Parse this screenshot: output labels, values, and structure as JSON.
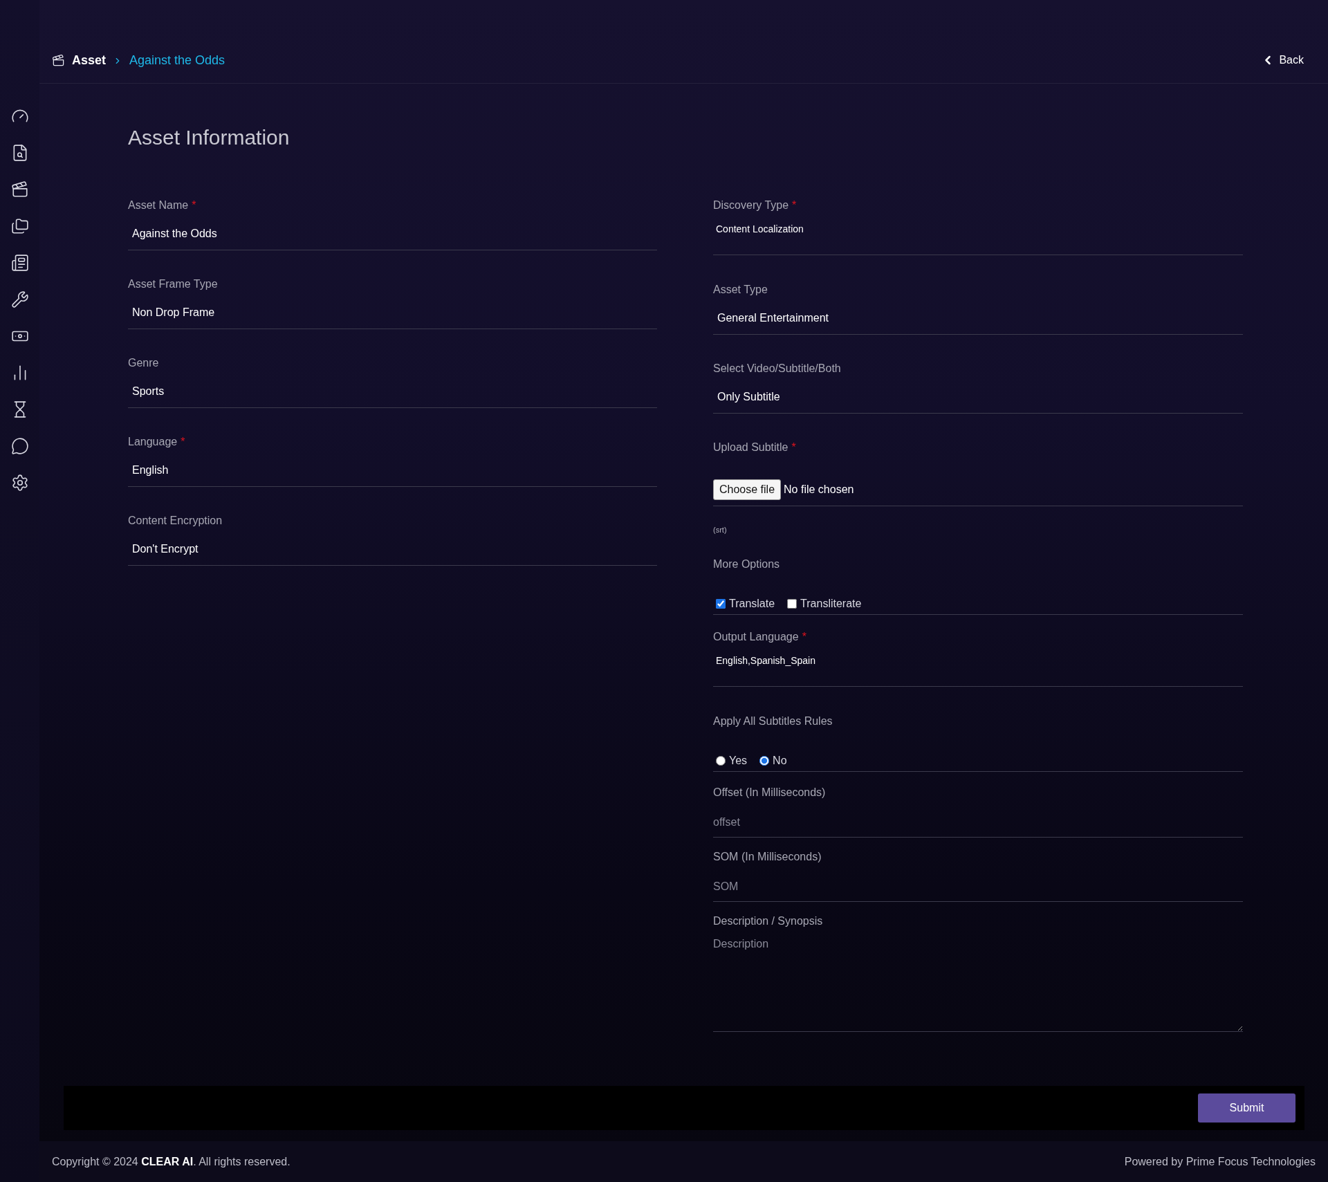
{
  "breadcrumb": [
    {
      "label": "Asset",
      "current": false
    },
    {
      "label": "Against the Odds",
      "current": true
    }
  ],
  "back_button": {
    "label": "Back"
  },
  "form": {
    "title": "Asset Information",
    "left_fields": [
      {
        "kind": "select",
        "label": "Asset Name",
        "required_mark": "*",
        "value": "Against the Odds"
      },
      {
        "kind": "select",
        "label": "Asset Frame Type",
        "value": "Non Drop Frame"
      },
      {
        "kind": "select",
        "label": "Genre",
        "value": "Sports"
      },
      {
        "kind": "select",
        "label": "Language",
        "required_mark": "*",
        "value": "English"
      },
      {
        "kind": "select",
        "label": "Content Encryption",
        "value": "Don't Encrypt"
      }
    ],
    "right_fields": [
      {
        "kind": "text",
        "label": "Discovery Type",
        "required_mark": "*",
        "value": "Content Localization"
      },
      {
        "kind": "select",
        "label": "Asset Type",
        "value": "General Entertainment"
      },
      {
        "kind": "select",
        "label": "Select Video/Subtitle/Both",
        "value": "Only Subtitle"
      },
      {
        "kind": "file",
        "label": "Upload Subtitle",
        "required_mark": "*",
        "button": "Choose file",
        "status": "No file chosen",
        "hint": "(srt)"
      },
      {
        "kind": "checkboxes",
        "label": "More Options",
        "options": [
          {
            "label": "Translate",
            "checked": true
          },
          {
            "label": "Transliterate",
            "checked": false
          }
        ]
      },
      {
        "kind": "text",
        "label": "Output Language",
        "required_mark": "*",
        "value": "English,Spanish_Spain"
      },
      {
        "kind": "radios",
        "label": "Apply All Subtitles Rules",
        "options": [
          {
            "label": "Yes",
            "selected": false
          },
          {
            "label": "No",
            "selected": true
          }
        ]
      },
      {
        "kind": "input",
        "label": "Offset (In Milliseconds)",
        "placeholder": "offset"
      },
      {
        "kind": "input",
        "label": "SOM (In Milliseconds)",
        "placeholder": "SOM"
      },
      {
        "kind": "textarea",
        "label": "Description / Synopsis",
        "placeholder": "Description"
      }
    ]
  },
  "submit": {
    "label": "Submit"
  },
  "footer": {
    "copyright": "Copyright © 2024 **CLEAR AI**. All rights reserved.",
    "powered_by": "Powered by Prime Focus Technologies"
  }
}
